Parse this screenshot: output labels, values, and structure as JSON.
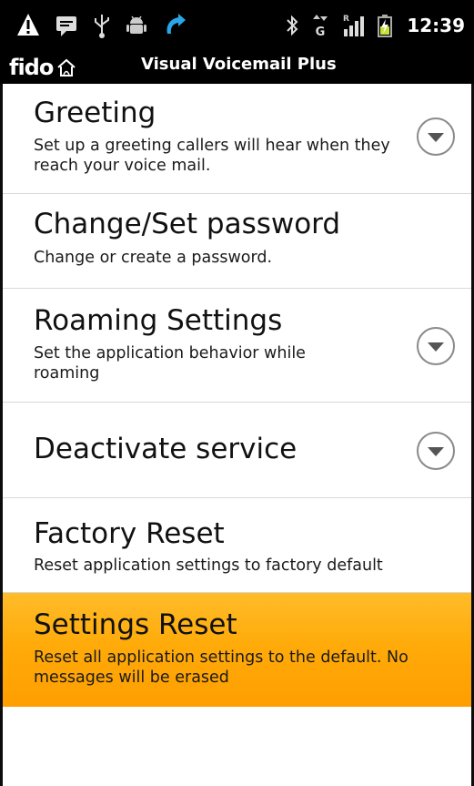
{
  "status_bar": {
    "icons": [
      "warning-icon",
      "message-icon",
      "usb-icon",
      "android-debug-icon",
      "call-forward-icon",
      "bluetooth-icon",
      "network-g-icon",
      "signal-strength-icon",
      "battery-charging-icon"
    ],
    "network_label": "G",
    "clock": "12:39"
  },
  "title_bar": {
    "brand": "fido",
    "title": "Visual Voicemail Plus"
  },
  "settings": [
    {
      "title": "Greeting",
      "summary": "Set up a greeting callers will hear when they reach your voice mail.",
      "has_dropdown": true
    },
    {
      "title": "Change/Set password",
      "summary": "Change or create a password.",
      "has_dropdown": false
    },
    {
      "title": "Roaming Settings",
      "summary": "Set the application behavior while roaming",
      "has_dropdown": true
    },
    {
      "title": "Deactivate service",
      "summary": "",
      "has_dropdown": true
    },
    {
      "title": "Factory Reset",
      "summary": "Reset application settings to factory default",
      "has_dropdown": false
    },
    {
      "title": "Settings Reset",
      "summary": "Reset all application settings to the default. No messages will be erased",
      "has_dropdown": false,
      "selected": true
    }
  ],
  "colors": {
    "selection_highlight": "#ffab0a",
    "call_forward_accent": "#2aa6e8",
    "battery_accent": "#c8e03a"
  }
}
